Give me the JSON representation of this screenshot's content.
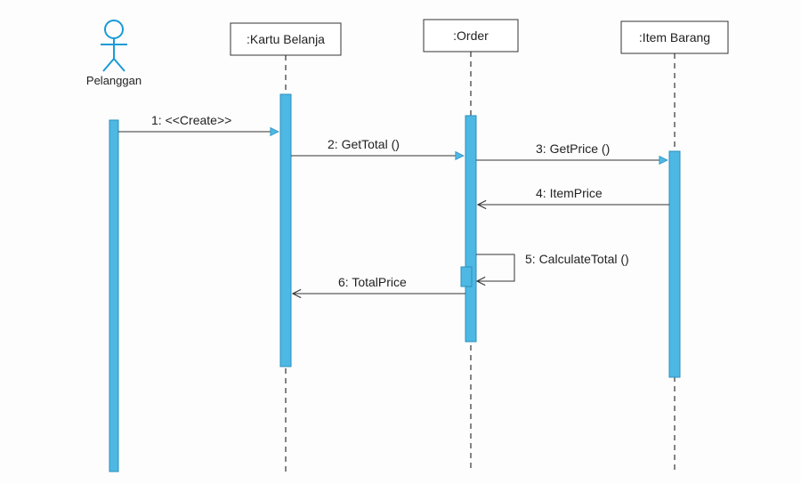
{
  "actor": {
    "name": "Pelanggan"
  },
  "participants": {
    "p1": ":Kartu Belanja",
    "p2": ":Order",
    "p3": ":Item Barang"
  },
  "messages": {
    "m1": "1: <<Create>>",
    "m2": "2: GetTotal ()",
    "m3": "3: GetPrice ()",
    "m4": "4: ItemPrice",
    "m5": "5: CalculateTotal ()",
    "m6": "6: TotalPrice"
  },
  "chart_data": {
    "type": "sequence-diagram",
    "actor": "Pelanggan",
    "participants": [
      ":Kartu Belanja",
      ":Order",
      ":Item Barang"
    ],
    "interactions": [
      {
        "seq": 1,
        "from": "Pelanggan",
        "to": ":Kartu Belanja",
        "label": "<<Create>>",
        "kind": "sync"
      },
      {
        "seq": 2,
        "from": ":Kartu Belanja",
        "to": ":Order",
        "label": "GetTotal ()",
        "kind": "sync"
      },
      {
        "seq": 3,
        "from": ":Order",
        "to": ":Item Barang",
        "label": "GetPrice ()",
        "kind": "sync"
      },
      {
        "seq": 4,
        "from": ":Item Barang",
        "to": ":Order",
        "label": "ItemPrice",
        "kind": "return"
      },
      {
        "seq": 5,
        "from": ":Order",
        "to": ":Order",
        "label": "CalculateTotal ()",
        "kind": "self"
      },
      {
        "seq": 6,
        "from": ":Order",
        "to": ":Kartu Belanja",
        "label": "TotalPrice",
        "kind": "return"
      }
    ]
  }
}
